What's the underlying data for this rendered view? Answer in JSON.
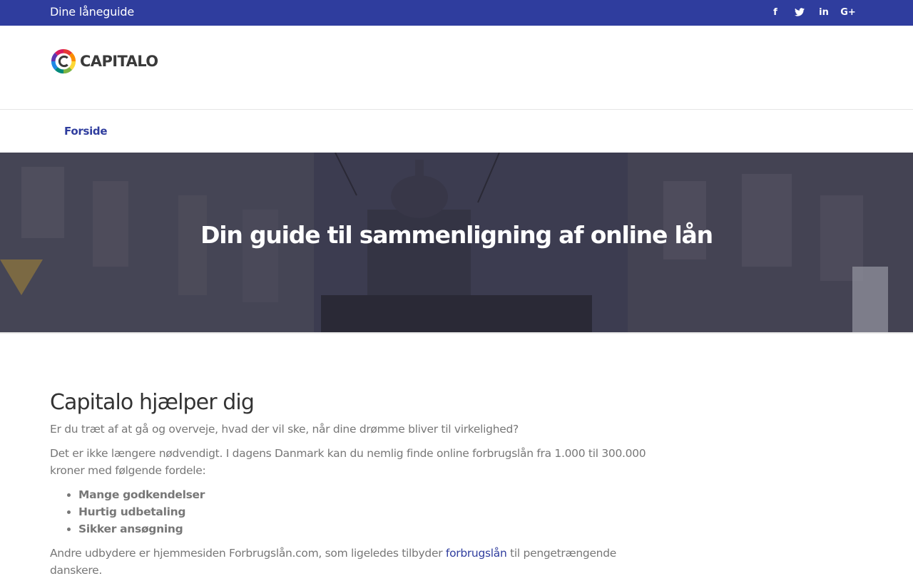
{
  "topbar": {
    "tagline": "Dine låneguide",
    "social": [
      {
        "icon": "facebook-icon",
        "glyph": "f"
      },
      {
        "icon": "twitter-icon",
        "glyph": "𝕥"
      },
      {
        "icon": "linkedin-icon",
        "glyph": "in"
      },
      {
        "icon": "google-plus-icon",
        "glyph": "G+"
      }
    ]
  },
  "brand": {
    "logo_text": "CAPITALO"
  },
  "nav": {
    "home_label": "Forside"
  },
  "hero": {
    "title": "Din guide til sammenligning af online lån"
  },
  "main": {
    "heading": "Capitalo hjælper dig",
    "intro": "Er du træt af at gå og overveje, hvad der vil ske, når dine drømme bliver til virkelighed?",
    "paragraph": "Det er ikke længere nødvendigt. I dagens Danmark kan du nemlig finde online forbrugslån fra 1.000 til 300.000 kroner med følgende fordele:",
    "benefits": [
      "Mange godkendelser",
      "Hurtig udbetaling",
      "Sikker ansøgning"
    ],
    "closing_before": "Andre udbydere er hjemmesiden Forbrugslån.com, som ligeledes tilbyder ",
    "closing_link": "forbrugslån",
    "closing_after": " til pengetrængende danskere."
  },
  "colors": {
    "topbar": "#2f3d9e",
    "link": "#2f3d9e",
    "heading": "#333333",
    "body_text": "#777777"
  }
}
